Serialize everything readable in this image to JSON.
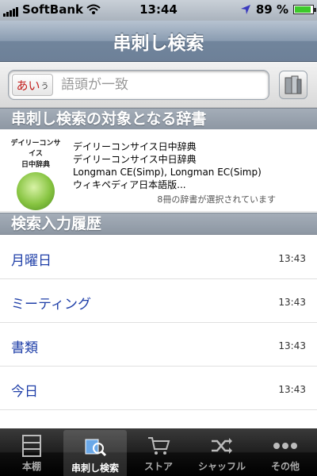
{
  "status": {
    "carrier": "SoftBank",
    "time": "13:44",
    "battery": "89 %",
    "battery_fraction": 0.89
  },
  "nav": {
    "title": "串刺し検索"
  },
  "search": {
    "mode_label": "あい",
    "mode_small": "う",
    "placeholder": "語頭が一致",
    "value": ""
  },
  "sections": {
    "dicts_title": "串刺し検索の対象となる辞書",
    "history_title": "検索入力履歴"
  },
  "dicts": {
    "logo_line1": "デイリーコンサイス",
    "logo_line2": "日中辞典",
    "items": [
      "デイリーコンサイス日中辞典",
      "デイリーコンサイス中日辞典",
      "Longman CE(Simp), Longman EC(Simp)",
      "ウィキペディア日本語版..."
    ],
    "selected_count": "8冊の辞書が選択されています"
  },
  "history": [
    {
      "word": "月曜日",
      "time": "13:43"
    },
    {
      "word": "ミーティング",
      "time": "13:43"
    },
    {
      "word": "書類",
      "time": "13:43"
    },
    {
      "word": "今日",
      "time": "13:43"
    }
  ],
  "tabs": [
    {
      "label": "本棚",
      "icon": "bookshelf-icon"
    },
    {
      "label": "串刺し検索",
      "icon": "cross-search-icon",
      "active": true
    },
    {
      "label": "ストア",
      "icon": "cart-icon"
    },
    {
      "label": "シャッフル",
      "icon": "shuffle-icon"
    },
    {
      "label": "その他",
      "icon": "more-icon"
    }
  ],
  "colors": {
    "nav_bar": "#7f92a8",
    "history_text": "#1f3fa8",
    "battery": "#3cc92a",
    "mode_badge_text": "#c3201e"
  }
}
